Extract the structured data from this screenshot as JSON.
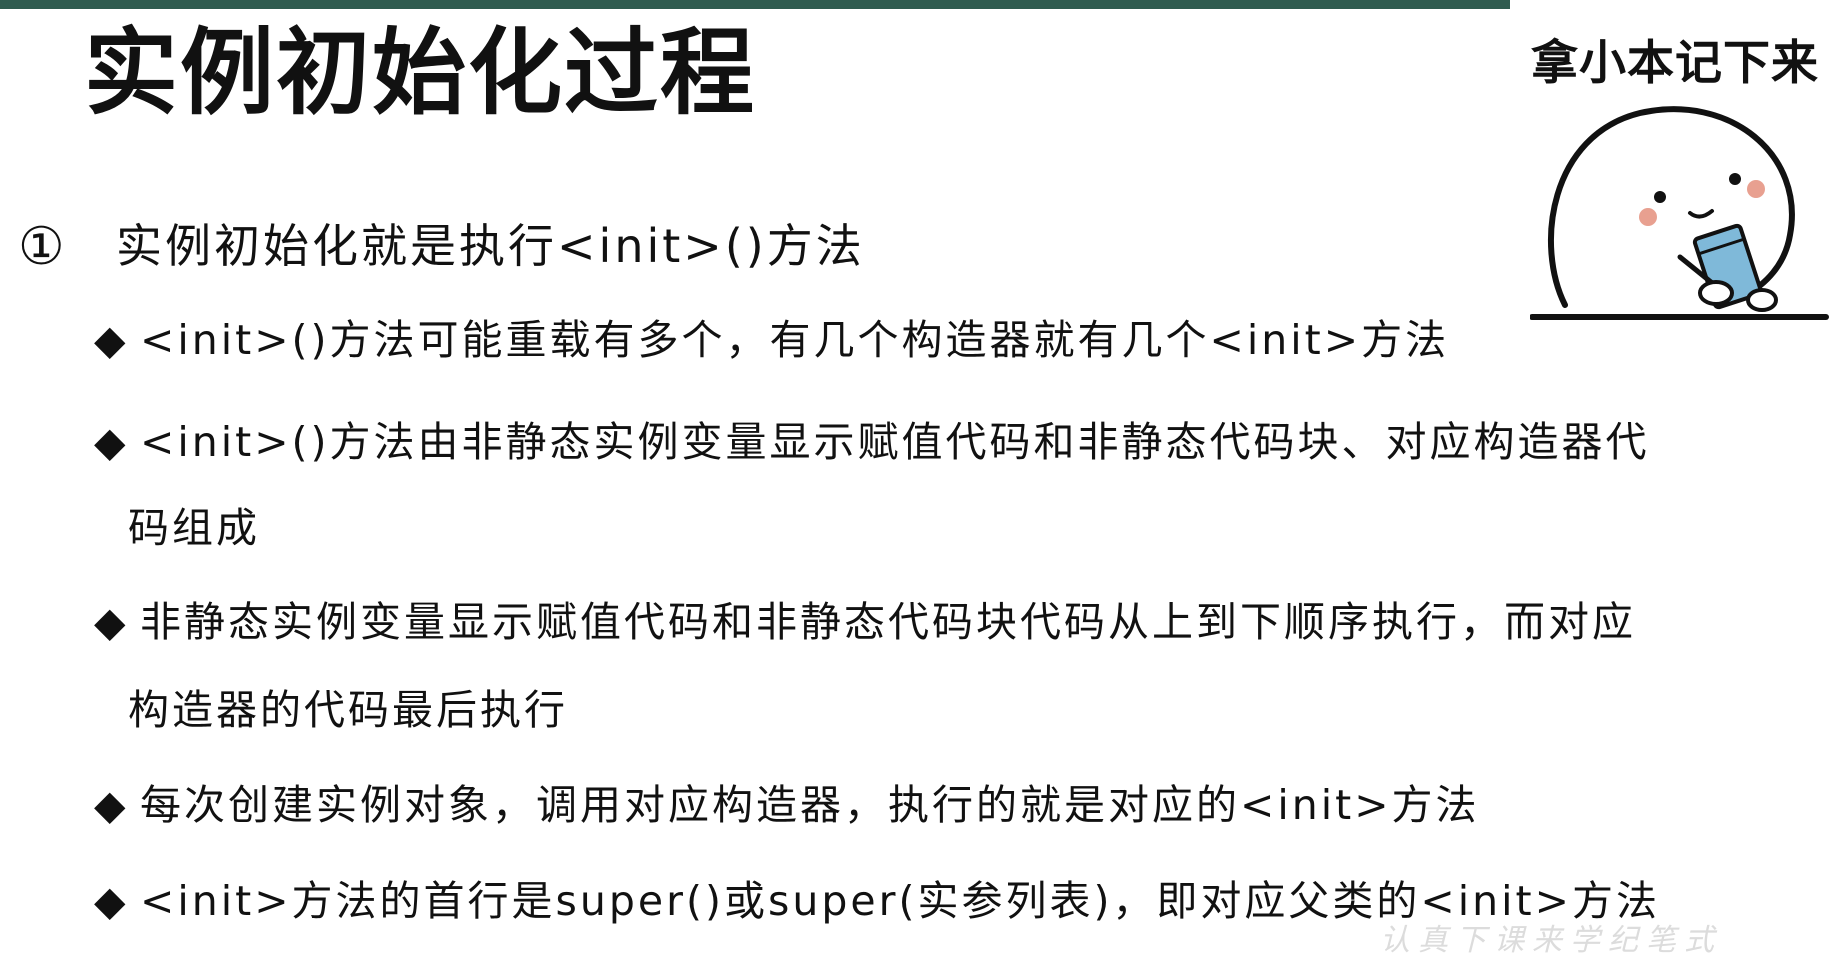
{
  "slide": {
    "title": "实例初始化过程",
    "item": {
      "number": "①",
      "text": "实例初始化就是执行<init>()方法"
    },
    "bullets": [
      {
        "mark": "◆",
        "line1": "<init>()方法可能重载有多个，有几个构造器就有几个<init>方法",
        "line2": ""
      },
      {
        "mark": "◆",
        "line1": "<init>()方法由非静态实例变量显示赋值代码和非静态代码块、对应构造器代",
        "line2": "码组成"
      },
      {
        "mark": "◆",
        "line1": "非静态实例变量显示赋值代码和非静态代码块代码从上到下顺序执行，而对应",
        "line2": "构造器的代码最后执行"
      },
      {
        "mark": "◆",
        "line1": "每次创建实例对象，调用对应构造器，执行的就是对应的<init>方法",
        "line2": ""
      },
      {
        "mark": "◆",
        "line1": "<init>方法的首行是super()或super(实参列表)，即对应父类的<init>方法",
        "line2": ""
      }
    ],
    "sticker_caption": "拿小本记下来",
    "bottom_faint_text": "认真下课来学纪笔式"
  },
  "colors": {
    "top_rule": "#2f5b4f",
    "text": "#111111",
    "cheek": "#e8a090",
    "notebook": "#7fb9d9"
  }
}
